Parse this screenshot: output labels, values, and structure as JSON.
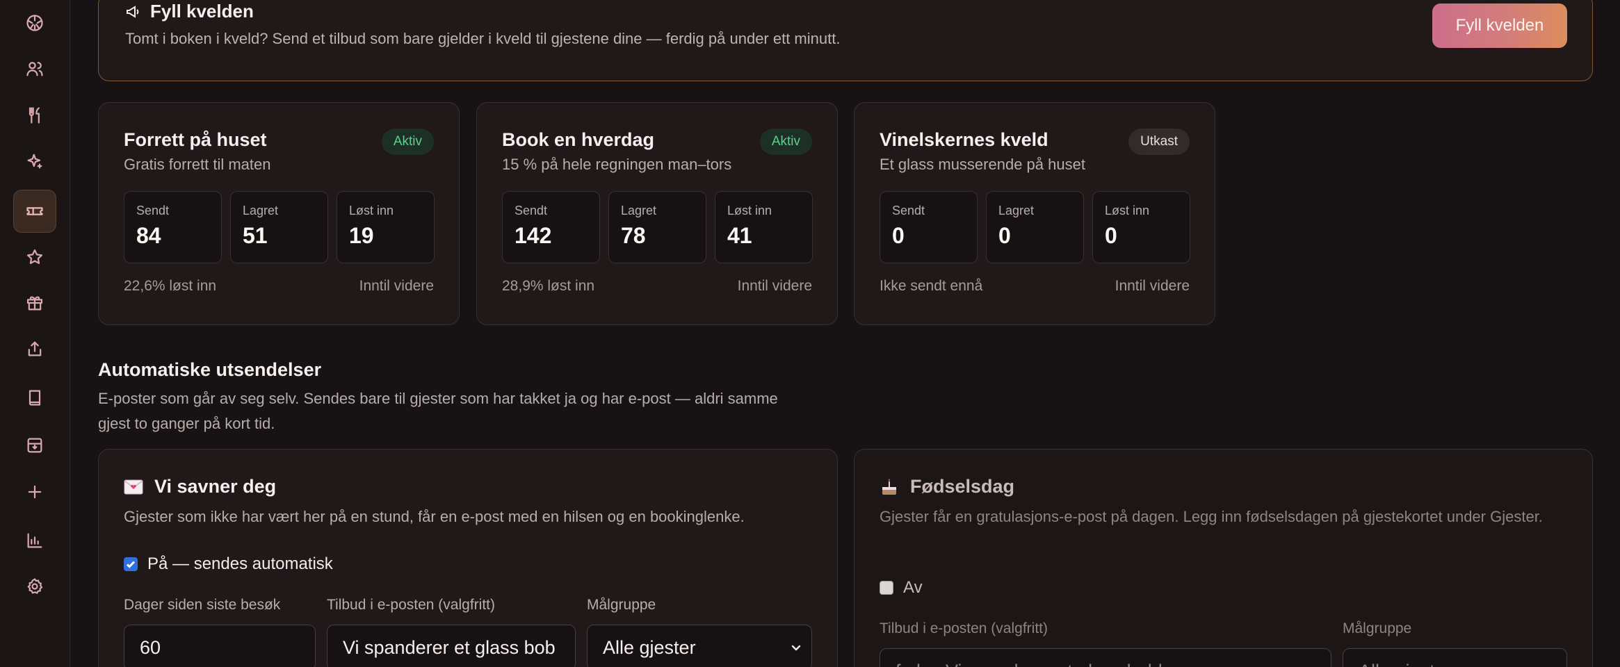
{
  "sidebar": {
    "items": [
      {
        "icon": "palette-icon",
        "name": "sidebar-item-dashboard"
      },
      {
        "icon": "users-icon",
        "name": "sidebar-item-guests"
      },
      {
        "icon": "utensils-icon",
        "name": "sidebar-item-menu"
      },
      {
        "icon": "sparkles-icon",
        "name": "sidebar-item-ai"
      },
      {
        "icon": "ticket-icon",
        "name": "sidebar-item-offers",
        "active": true
      },
      {
        "icon": "star-icon",
        "name": "sidebar-item-reviews"
      },
      {
        "icon": "gift-icon",
        "name": "sidebar-item-gifts"
      },
      {
        "icon": "share-icon",
        "name": "sidebar-item-share"
      },
      {
        "icon": "book-icon",
        "name": "sidebar-item-bookings"
      },
      {
        "icon": "archive-icon",
        "name": "sidebar-item-archive"
      },
      {
        "icon": "plus-icon",
        "name": "sidebar-item-add"
      },
      {
        "icon": "bar-chart-icon",
        "name": "sidebar-item-stats"
      },
      {
        "icon": "settings-icon",
        "name": "sidebar-item-settings"
      }
    ]
  },
  "banner": {
    "title": "Fyll kvelden",
    "description": "Tomt i boken i kveld? Send et tilbud som bare gjelder i kveld til gjestene dine — ferdig på under ett minutt.",
    "button": "Fyll kvelden"
  },
  "offers": [
    {
      "title": "Forrett på huset",
      "subtitle": "Gratis forrett til maten",
      "status": "Aktiv",
      "stats": [
        {
          "label": "Sendt",
          "value": "84"
        },
        {
          "label": "Lagret",
          "value": "51"
        },
        {
          "label": "Løst inn",
          "value": "19"
        }
      ],
      "foot_left": "22,6% løst inn",
      "foot_right": "Inntil videre"
    },
    {
      "title": "Book en hverdag",
      "subtitle": "15 % på hele regningen man–tors",
      "status": "Aktiv",
      "stats": [
        {
          "label": "Sendt",
          "value": "142"
        },
        {
          "label": "Lagret",
          "value": "78"
        },
        {
          "label": "Løst inn",
          "value": "41"
        }
      ],
      "foot_left": "28,9% løst inn",
      "foot_right": "Inntil videre"
    },
    {
      "title": "Vinelskernes kveld",
      "subtitle": "Et glass musserende på huset",
      "status": "Utkast",
      "stats": [
        {
          "label": "Sendt",
          "value": "0"
        },
        {
          "label": "Lagret",
          "value": "0"
        },
        {
          "label": "Løst inn",
          "value": "0"
        }
      ],
      "foot_left": "Ikke sendt ennå",
      "foot_right": "Inntil videre"
    }
  ],
  "automations": {
    "title": "Automatiske utsendelser",
    "description": "E-poster som går av seg selv. Sendes bare til gjester som har takket ja og har e-post — aldri samme gjest to ganger på kort tid.",
    "items": [
      {
        "emoji": "💌",
        "title": "Vi savner deg",
        "description": "Gjester som ikke har vært her på en stund, får en e-post med en hilsen og en bookinglenke.",
        "toggle": "På — sendes automatisk",
        "enabled": true,
        "days_label": "Dager siden siste besøk",
        "days_value": "60",
        "offer_label": "Tilbud i e-posten (valgfritt)",
        "offer_value": "Vi spanderer et glass bob",
        "group_label": "Målgruppe",
        "group_value": "Alle gjester"
      },
      {
        "emoji": "🎂",
        "title": "Fødselsdag",
        "description": "Gjester får en gratulasjons-e-post på dagen. Legg inn fødselsdagen på gjestekortet under Gjester.",
        "toggle": "Av",
        "enabled": false,
        "offer_label": "Tilbud i e-posten (valgfritt)",
        "offer_value": "f.eks. Vi spanderer et glass bobler",
        "group_label": "Målgruppe",
        "group_value": "Alle gjester"
      }
    ]
  },
  "colors": {
    "accent_start": "#cd6e8c",
    "accent_end": "#dd8e5c",
    "active_badge": "#5fce8d"
  }
}
